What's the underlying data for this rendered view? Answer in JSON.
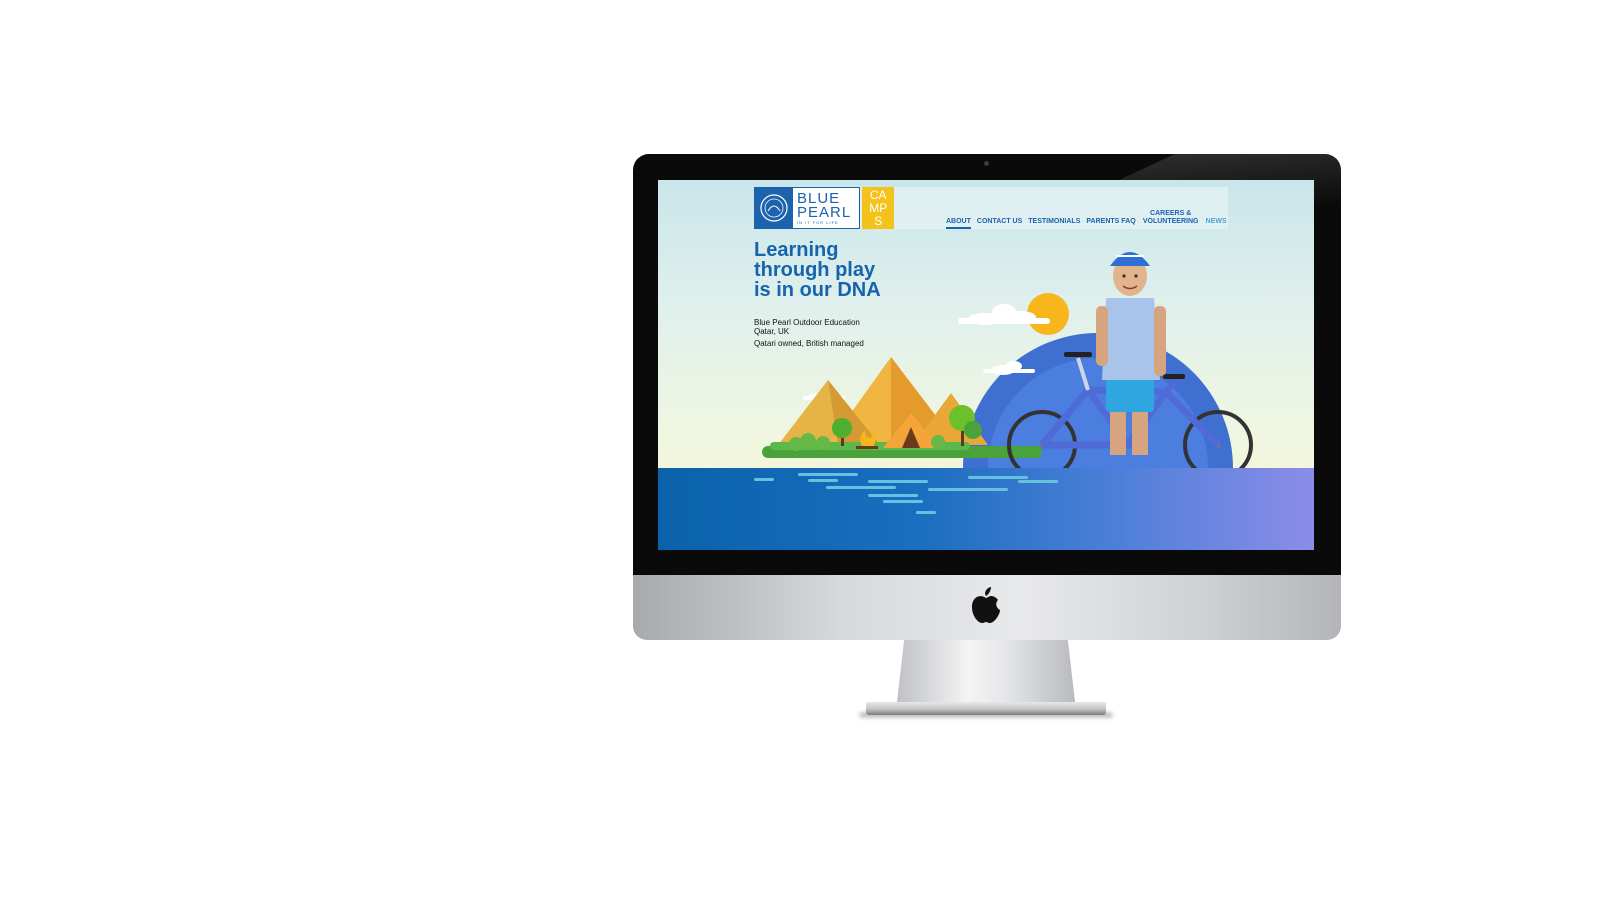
{
  "logo": {
    "wordmark_line1": "BLUE",
    "wordmark_line2": "PEARL",
    "tagline": "IN IT FOR LIFE",
    "camps_line1": "CA",
    "camps_line2": "MP",
    "camps_line3": "S"
  },
  "nav": {
    "items": [
      {
        "label": "ABOUT"
      },
      {
        "label": "CONTACT US"
      },
      {
        "label": "TESTIMONIALS"
      },
      {
        "label": "PARENTS FAQ"
      },
      {
        "label": "CAREERS & VOLUNTEERING"
      },
      {
        "label": "NEWS"
      }
    ]
  },
  "hero": {
    "title_line1": "Learning",
    "title_line2": "through play",
    "title_line3": "is in our DNA",
    "sub_line1": "Blue Pearl Outdoor Education Qatar, UK",
    "sub_line2": "Qatari owned, British managed"
  },
  "colors": {
    "brand_blue": "#1b63ad",
    "camps_yellow": "#f3c21b",
    "sun": "#f7b71c",
    "water": "#0a62aa"
  },
  "icons": [
    "apple-logo-icon",
    "pearl-seal-icon",
    "tent-icon",
    "campfire-icon",
    "sun-icon",
    "cloud-icon"
  ]
}
